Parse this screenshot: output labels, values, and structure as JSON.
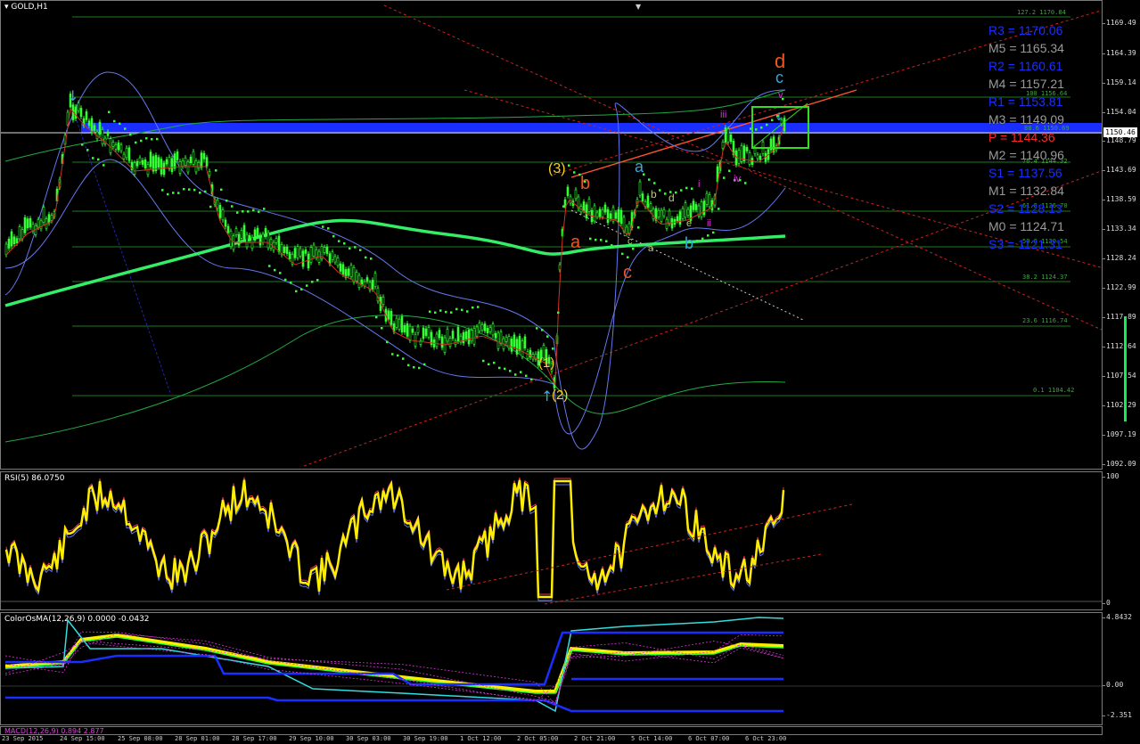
{
  "main": {
    "title": "GOLD,H1",
    "current_price": "1150.46",
    "price_scale": [
      "1169.49",
      "1164.39",
      "1159.14",
      "1154.04",
      "1148.79",
      "1143.69",
      "1138.59",
      "1133.34",
      "1128.24",
      "1122.99",
      "1117.89",
      "1112.64",
      "1107.54",
      "1102.29",
      "1097.19",
      "1092.09"
    ],
    "pivots": [
      {
        "label": "R3 = 1170.06",
        "color": "#1a2fff"
      },
      {
        "label": "M5 = 1165.34",
        "color": "#9a9a9a"
      },
      {
        "label": "R2 = 1160.61",
        "color": "#1a2fff"
      },
      {
        "label": "M4 = 1157.21",
        "color": "#9a9a9a"
      },
      {
        "label": "R1 = 1153.81",
        "color": "#1a2fff"
      },
      {
        "label": "M3 = 1149.09",
        "color": "#9a9a9a"
      },
      {
        "label": "P  = 1144.36",
        "color": "#ff2a2a"
      },
      {
        "label": "M2 = 1140.96",
        "color": "#9a9a9a"
      },
      {
        "label": "S1 = 1137.56",
        "color": "#1a2fff"
      },
      {
        "label": "M1 = 1132.84",
        "color": "#9a9a9a"
      },
      {
        "label": "S2 = 1128.13",
        "color": "#1a2fff"
      },
      {
        "label": "M0 = 1124.71",
        "color": "#9a9a9a"
      },
      {
        "label": "S3 = 1121.31",
        "color": "#1a2fff"
      }
    ],
    "fib_levels": [
      "127.2 1170.84",
      "100 1156.64",
      "88.6 1150.69",
      "76.4 1144.32",
      "61.8 1136.70",
      "50.0 1130.54",
      "38.2 1124.37",
      "23.6 1116.74",
      "0.1 1104.42"
    ],
    "waves": [
      "(3)",
      "(1)",
      "(2)",
      "a",
      "b",
      "c",
      "a",
      "b",
      "c",
      "d",
      "a",
      "b",
      "c",
      "d",
      "e",
      "i",
      "ii",
      "iii",
      "iv",
      "v"
    ]
  },
  "rsi": {
    "title": "RSI(5) 86.0750",
    "scale": [
      "100",
      "0"
    ]
  },
  "osma": {
    "title": "ColorOsMA(12,26,9) 0.0000 -0.0432",
    "scale": [
      "4.8432",
      "0.00",
      "-2.351"
    ]
  },
  "macd": {
    "title": "MACD(12,26,9) 0.894 2.877"
  },
  "time_axis": [
    "23 Sep 2015",
    "24 Sep 15:00",
    "25 Sep 08:00",
    "28 Sep 01:00",
    "28 Sep 17:00",
    "29 Sep 10:00",
    "30 Sep 03:00",
    "30 Sep 19:00",
    "1 Oct 12:00",
    "2 Oct 05:00",
    "2 Oct 21:00",
    "5 Oct 14:00",
    "6 Oct 07:00",
    "6 Oct 23:00"
  ],
  "colors": {
    "background": "#000000",
    "bull_candle": "#33ff33",
    "pivot_band": "#1a2fff",
    "ma_slow": "#33ee66",
    "rsi_line": "#ffee00",
    "highlight_box": "#33dd22"
  }
}
